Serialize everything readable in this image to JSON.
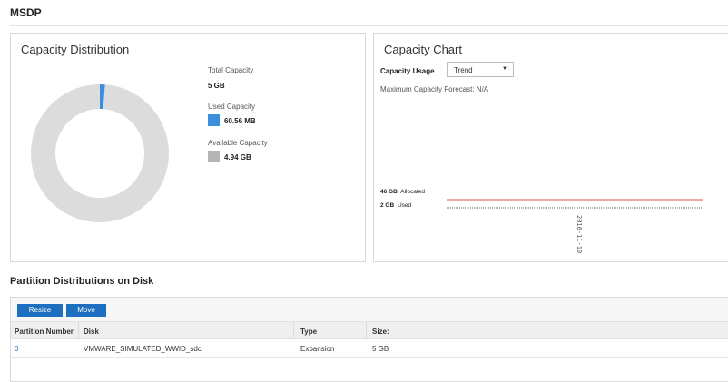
{
  "page": {
    "title": "MSDP"
  },
  "capacity_distribution": {
    "title": "Capacity Distribution",
    "total_label": "Total Capacity",
    "total_value": "5 GB",
    "used_label": "Used Capacity",
    "used_value": "60.56 MB",
    "available_label": "Available Capacity",
    "available_value": "4.94 GB",
    "used_fraction": 0.0118,
    "colors": {
      "used": "#3c8fde",
      "available": "#dcdcdc"
    }
  },
  "capacity_chart": {
    "title": "Capacity Chart",
    "usage_label": "Capacity Usage",
    "usage_select": "Trend",
    "forecast": "Maximum Capacity Forecast: N/A",
    "allocated_value": "46 GB",
    "allocated_word": "Allocated",
    "used_value": "2 GB",
    "used_word": "Used",
    "date_tick": "2016-11-10",
    "colors": {
      "allocated": "#d9534f",
      "used": "#666666"
    }
  },
  "partitions": {
    "title": "Partition Distributions on Disk",
    "toolbar": {
      "resize_label": "Resize",
      "move_label": "Move"
    },
    "columns": [
      "Partition Number",
      "Disk",
      "Type",
      "Size:"
    ],
    "rows": [
      [
        "0",
        "VMWARE_SIMULATED_WWID_sdc",
        "Expansion",
        "5 GB"
      ]
    ]
  }
}
